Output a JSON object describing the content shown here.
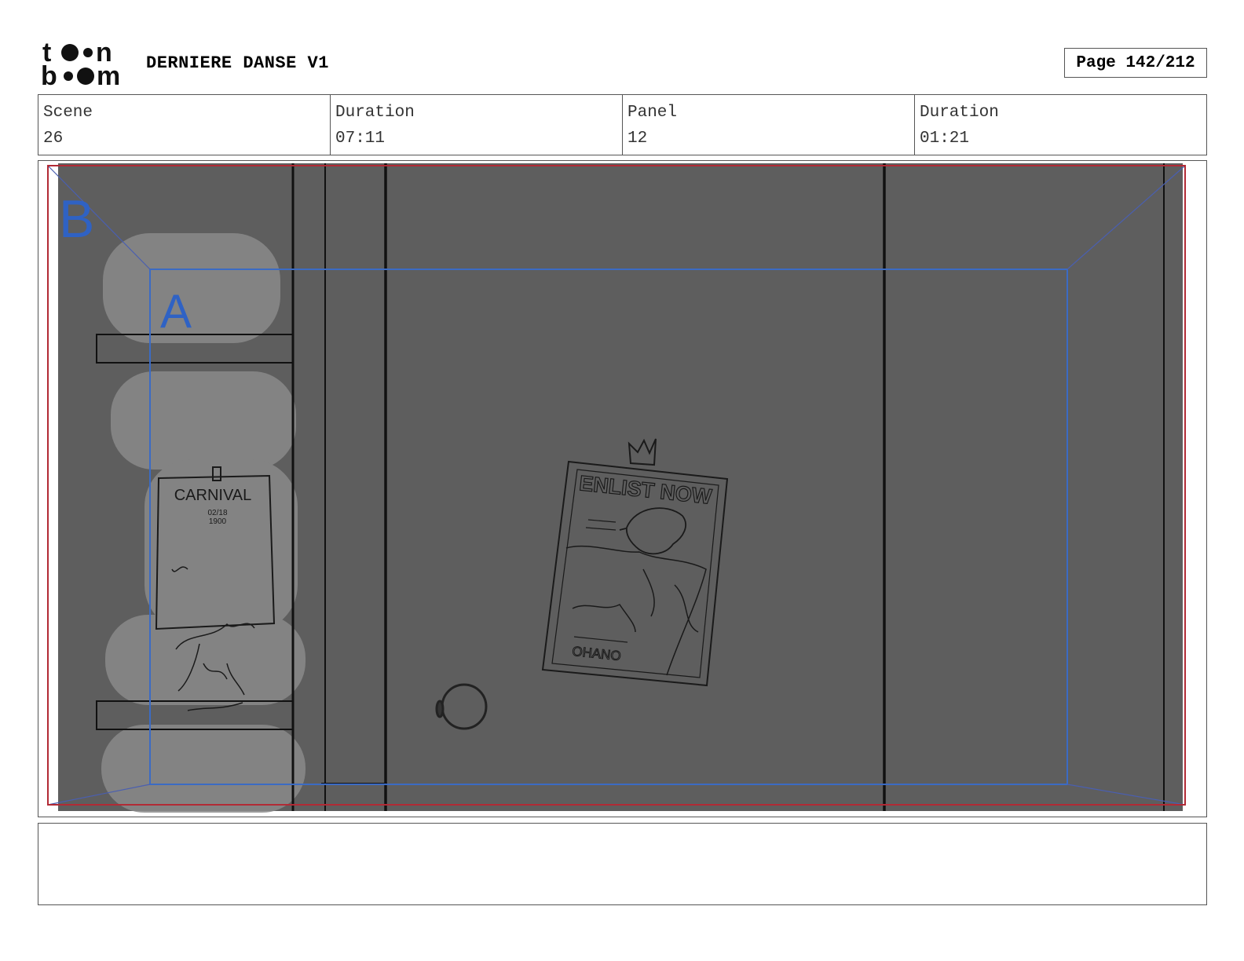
{
  "header": {
    "logo_text": "toon boom",
    "project_title": "DERNIERE DANSE V1",
    "page_label": "Page 142/212"
  },
  "info": {
    "scene_label": "Scene",
    "scene_value": "26",
    "scene_duration_label": "Duration",
    "scene_duration_value": "07:11",
    "panel_label": "Panel",
    "panel_value": "12",
    "panel_duration_label": "Duration",
    "panel_duration_value": "01:21"
  },
  "panel": {
    "camera_label_b": "B",
    "camera_label_a": "A",
    "left_poster": {
      "title": "CARNIVAL",
      "date": "02/18",
      "time": "1900"
    },
    "right_poster": {
      "title": "ENLIST NOW",
      "footer": "OHANO"
    },
    "colors": {
      "background": "#5e5e5e",
      "safe_frame": "#b22a35",
      "camera_frame": "#3b6bc4",
      "highlight": "#8a8a8a"
    }
  },
  "notes": {}
}
